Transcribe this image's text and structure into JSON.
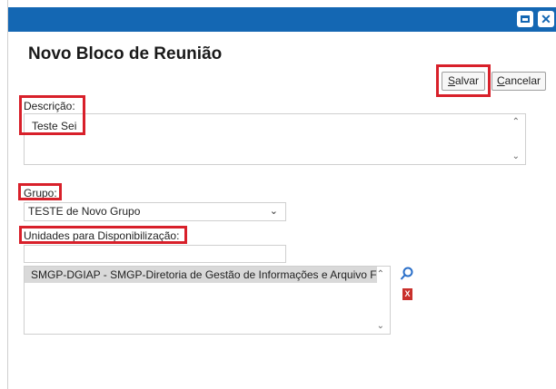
{
  "window": {
    "maximize_icon": "window-maximize-icon",
    "close_icon": "close-icon",
    "close_glyph": "✕",
    "titlebar_color": "#1467b3"
  },
  "page": {
    "title": "Novo Bloco de Reunião"
  },
  "toolbar": {
    "save_key": "S",
    "save_rest": "alvar",
    "cancel_key": "C",
    "cancel_rest": "ancelar"
  },
  "form": {
    "descricao_label": "Descrição:",
    "descricao_value": "Teste Sei",
    "grupo_label": "Grupo:",
    "grupo_value": "TESTE de Novo Grupo",
    "unidades_label": "Unidades para Disponibilização:",
    "unidades_input_value": "",
    "unidades_list": [
      "SMGP-DGIAP - SMGP-Diretoria de Gestão de Informações e Arquivo F"
    ]
  },
  "icons": {
    "search": "search-icon",
    "remove": "remove-icon",
    "remove_glyph": "X",
    "remove_color": "#c9302c"
  },
  "highlight_color": "#d8202a"
}
